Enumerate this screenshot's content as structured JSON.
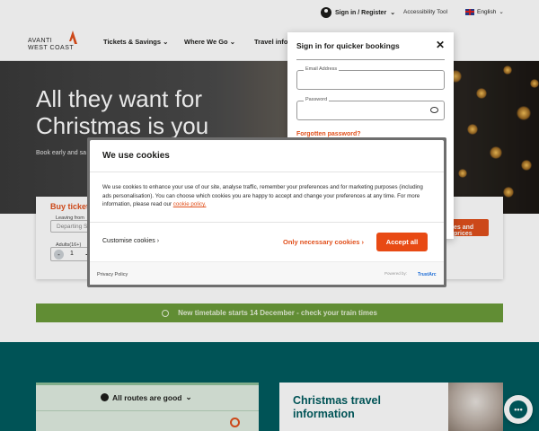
{
  "utility": {
    "signin": "Sign in / Register",
    "accessibility": "Accessibility Tool",
    "language": "English"
  },
  "nav": {
    "logo_line1": "AVANTI",
    "logo_line2": "WEST COAST",
    "items": [
      "Tickets & Savings",
      "Where We Go",
      "Travel info"
    ]
  },
  "hero": {
    "title_line1": "All they want for",
    "title_line2": "Christmas is you",
    "subtitle": "Book early and ",
    "subtitle_fragment": "sa"
  },
  "booking": {
    "title": "Buy tickets",
    "leaving_label": "Leaving from",
    "leaving_placeholder": "Departing St",
    "adults_label": "Adults(16+)",
    "adults_minus": "-",
    "adults_value": "1",
    "adults_plus": "+",
    "times_button": "es and prices"
  },
  "banner": {
    "text": "New timetable starts 14 December - check your train times"
  },
  "routes": {
    "title": "All routes are good"
  },
  "christmas_card": {
    "title": "Christmas travel information"
  },
  "signin_panel": {
    "title": "Sign in for quicker bookings",
    "close": "✕",
    "email_label": "Email Address",
    "password_label": "Password",
    "forgot": "Forgotten password?"
  },
  "cookie": {
    "title": "We use cookies",
    "body": "We use cookies to enhance your use of our site, analyse traffic, remember your preferences and for marketing purposes (including ads personalisation). You can choose which cookies you are happy to accept and change your preferences at any time. For more information, please read our ",
    "link": "cookie policy.",
    "customise": "Customise cookies ›",
    "only_necessary": "Only necessary cookies ›",
    "accept_all": "Accept all",
    "privacy": "Privacy Policy",
    "powered": "Powered by:",
    "trustarc": "TrustArc"
  },
  "colors": {
    "accent": "#e1501c",
    "teal": "#005c5f",
    "green": "#6b9b3a"
  },
  "icons": [
    "user-icon",
    "chevron-down-icon",
    "flag-icon",
    "close-icon",
    "eye-icon",
    "check-circle-icon",
    "pin-icon",
    "chat-icon"
  ]
}
